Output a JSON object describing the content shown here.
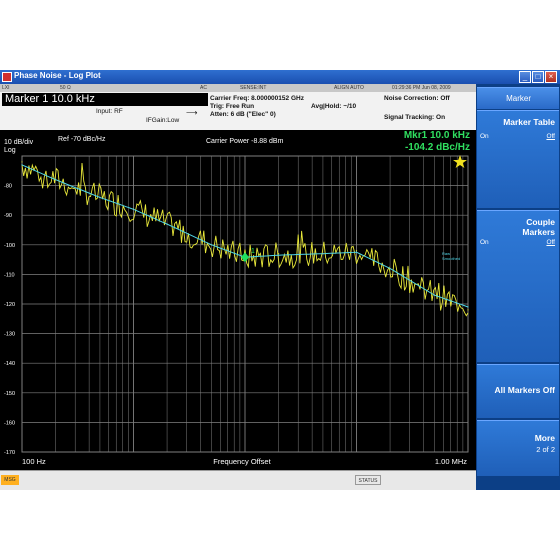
{
  "window": {
    "title": "Phase Noise - Log Plot",
    "minimize": "_",
    "maximize": "□",
    "close": "×"
  },
  "menubar": {
    "cells": [
      "LXI",
      "50 Ω",
      "AC",
      "SENSE:INT",
      "ALIGN AUTO",
      "01:29:36 PM Jun 08, 2009"
    ]
  },
  "info": {
    "marker": "Marker 1  10.0 kHz",
    "input": "Input: RF",
    "ifgain": "IFGain:Low",
    "carrier_freq": "Carrier Freq: 8.000000152 GHz",
    "trig": "Trig: Free Run",
    "atten": "Atten: 6 dB (\"Elec\" 0)",
    "avg_hold": "Avg|Hold: ~/10",
    "noise_corr": "Noise Correction: Off",
    "signal_tracking": "Signal Tracking: On"
  },
  "plot": {
    "scale": "10 dB/div",
    "scale_type": "Log",
    "ref": "Ref  -70 dBc/Hz",
    "carrier_power": "Carrier Power -8.88 dBm",
    "mkr_readout_1": "Mkr1 10.0 kHz",
    "mkr_readout_2": "-104.2  dBc/Hz",
    "x_start": "100 Hz",
    "x_label": "Frequency Offset",
    "x_stop": "1.00 MHz",
    "y_ticks": [
      "-80",
      "-90",
      "-100",
      "-110",
      "-120",
      "-130",
      "-140",
      "-150",
      "-160",
      "-170"
    ],
    "trace_labels": [
      "Raw",
      "Smoothed"
    ],
    "marker_label": "1"
  },
  "chart_data": {
    "type": "line",
    "scale": "log-x",
    "xlim": [
      100,
      1000000
    ],
    "ylim": [
      -170,
      -70
    ],
    "x": [
      100,
      200,
      500,
      1000,
      2000,
      5000,
      10000,
      20000,
      50000,
      100000,
      200000,
      500000,
      1000000
    ],
    "series": [
      {
        "name": "Raw",
        "values": [
          -72,
          -78,
          -84,
          -88,
          -93,
          -100,
          -104,
          -103,
          -103,
          -102,
          -108,
          -117,
          -122
        ]
      },
      {
        "name": "Smoothed",
        "values": [
          -73,
          -78,
          -84,
          -88,
          -93,
          -100,
          -104.2,
          -103.5,
          -103,
          -102.5,
          -108,
          -117,
          -121
        ]
      }
    ],
    "marker": {
      "x": 10000,
      "y": -104.2,
      "label": "1"
    },
    "colors": {
      "raw": "#e8e83a",
      "smoothed": "#4fd6e8",
      "marker": "#20e060",
      "grid": "#808080"
    }
  },
  "softkeys": {
    "header": "Marker",
    "marker_table": "Marker Table",
    "marker_table_on": "On",
    "marker_table_off": "Off",
    "couple_markers_1": "Couple",
    "couple_markers_2": "Markers",
    "couple_on": "On",
    "couple_off": "Off",
    "all_markers_off": "All Markers Off",
    "more": "More",
    "page": "2 of 2"
  },
  "status": {
    "msg": "MSG",
    "label": "STATUS"
  }
}
